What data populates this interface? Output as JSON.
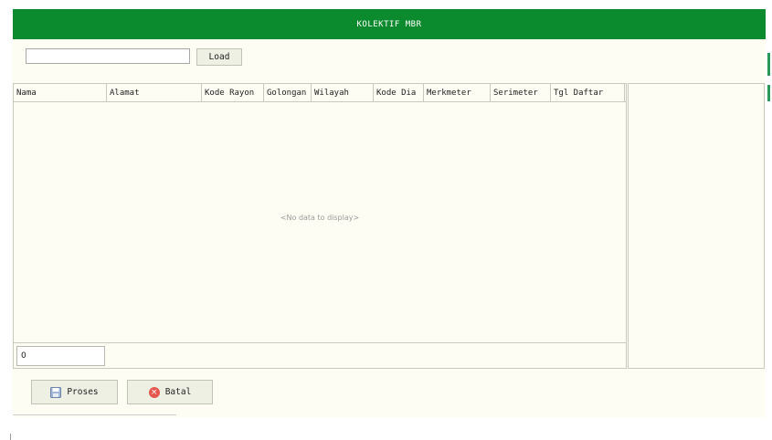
{
  "title": "KOLEKTIF MBR",
  "search": {
    "value": "",
    "load_label": "Load"
  },
  "grid": {
    "columns": [
      "Nama",
      "Alamat",
      "Kode Rayon",
      "Golongan",
      "Wilayah",
      "Kode Dia",
      "Merkmeter",
      "Serimeter",
      "Tgl Daftar"
    ],
    "empty_message": "<No data to display>",
    "count": "0"
  },
  "actions": {
    "proses_label": "Proses",
    "batal_label": "Batal"
  },
  "colors": {
    "header_green": "#0b8a2e",
    "panel_bg": "#fdfdf3",
    "cancel_red": "#e5574c"
  }
}
